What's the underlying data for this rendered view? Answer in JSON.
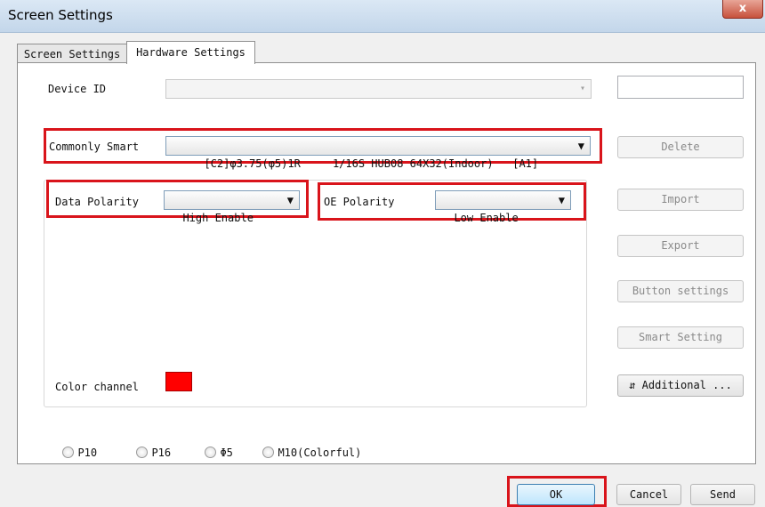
{
  "window": {
    "title": "Screen Settings",
    "close_glyph": "x"
  },
  "tabs": [
    {
      "label": "Screen Settings"
    },
    {
      "label": "Hardware Settings"
    }
  ],
  "device_id": {
    "label": "Device ID",
    "value": "",
    "text_value": ""
  },
  "commonly_smart": {
    "label": "Commonly Smart",
    "value": "[C2]φ3.75(φ5)1R     1/16S HUB08 64X32(Indoor)   [A1]"
  },
  "data_polarity": {
    "label": "Data Polarity",
    "value": "High Enable"
  },
  "oe_polarity": {
    "label": "OE Polarity",
    "value": "Low Enable"
  },
  "color_channel": {
    "label": "Color channel",
    "color": "#ff0000"
  },
  "side_buttons": {
    "delete": "Delete",
    "import": "Import",
    "export": "Export",
    "button_settings": "Button settings",
    "smart_setting": "Smart Setting",
    "additional": "Additional ...",
    "additional_icon": "⇵"
  },
  "radios": [
    {
      "label": "P10",
      "checked": false
    },
    {
      "label": "P16",
      "checked": false
    },
    {
      "label": "Φ5",
      "checked": false
    },
    {
      "label": "M10(Colorful)",
      "checked": false
    }
  ],
  "footer": {
    "ok": "OK",
    "cancel": "Cancel",
    "send": "Send"
  },
  "highlight_color": "#d9141b",
  "icons": {
    "dropdown": "▼",
    "dropdown_disabled": "▾"
  }
}
